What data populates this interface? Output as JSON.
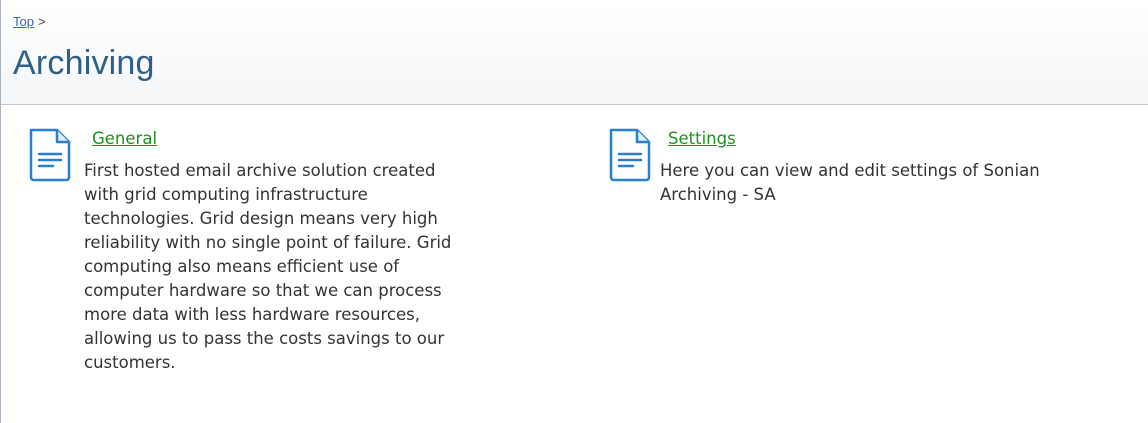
{
  "breadcrumb": {
    "top_link": "Top",
    "separator": ">"
  },
  "page": {
    "title": "Archiving"
  },
  "items": [
    {
      "label": "General",
      "icon": "document-icon",
      "description_lines": [
        "First hosted email archive solution created",
        "with grid computing infrastructure",
        "technologies. Grid design means very high",
        "reliability with no single point of failure. Grid",
        "computing also means efficient use of",
        "computer hardware so that we can process",
        "more data with less hardware resources,",
        "allowing us to pass the costs savings to our",
        "customers."
      ]
    },
    {
      "label": "Settings",
      "icon": "document-icon",
      "description_lines": [
        "Here you can view and edit settings of Sonian",
        "Archiving - SA"
      ]
    }
  ],
  "colors": {
    "title": "#2f5f86",
    "link": "#1f8f1f",
    "breadcrumb_link": "#3a63b8",
    "icon_stroke": "#2a7fcf"
  }
}
